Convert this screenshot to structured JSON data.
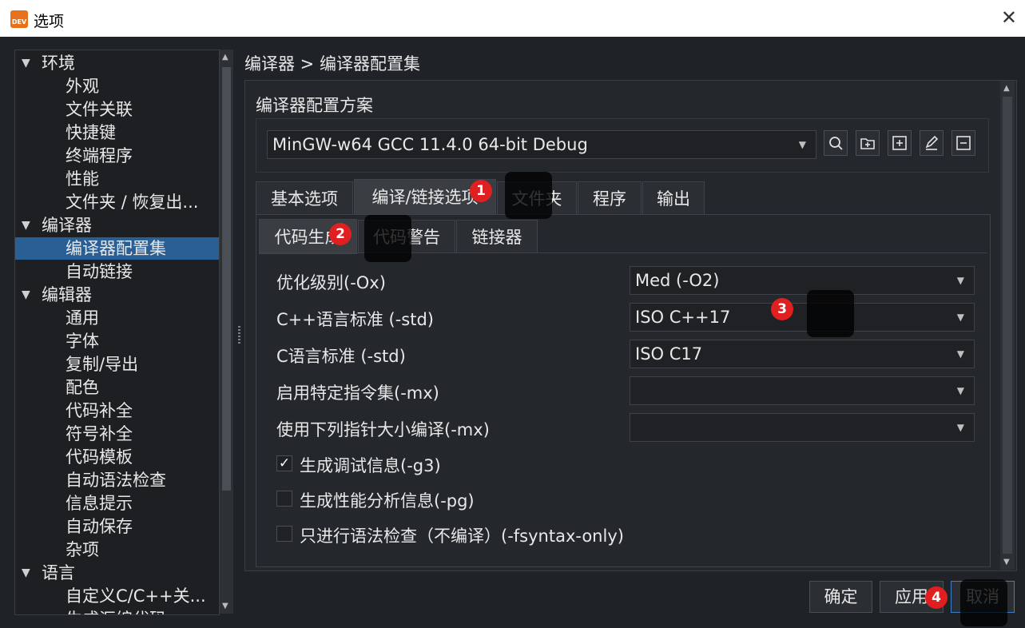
{
  "window": {
    "title": "选项",
    "app_icon_text": "DEV",
    "close_icon": "close-icon"
  },
  "tree": {
    "items": [
      {
        "label": "环境",
        "arrow": "▼"
      },
      {
        "label": "外观"
      },
      {
        "label": "文件关联"
      },
      {
        "label": "快捷键"
      },
      {
        "label": "终端程序"
      },
      {
        "label": "性能"
      },
      {
        "label": "文件夹 / 恢复出..."
      },
      {
        "label": "编译器",
        "arrow": "▼"
      },
      {
        "label": "编译器配置集"
      },
      {
        "label": "自动链接"
      },
      {
        "label": "编辑器",
        "arrow": "▼"
      },
      {
        "label": "通用"
      },
      {
        "label": "字体"
      },
      {
        "label": "复制/导出"
      },
      {
        "label": "配色"
      },
      {
        "label": "代码补全"
      },
      {
        "label": "符号补全"
      },
      {
        "label": "代码模板"
      },
      {
        "label": "自动语法检查"
      },
      {
        "label": "信息提示"
      },
      {
        "label": "自动保存"
      },
      {
        "label": "杂项"
      },
      {
        "label": "语言",
        "arrow": "▼"
      },
      {
        "label": "自定义C/C++关..."
      },
      {
        "label": "生成汇编代码"
      }
    ],
    "selected": "编译器配置集"
  },
  "breadcrumb": "编译器 > 编译器配置集",
  "profile": {
    "section_label": "编译器配置方案",
    "selected": "MinGW-w64 GCC 11.4.0 64-bit Debug",
    "actions": [
      "search-icon",
      "folder-add-icon",
      "plus-icon",
      "edit-icon",
      "minus-icon"
    ]
  },
  "tabs": {
    "items": [
      "基本选项",
      "编译/链接选项",
      "文件夹",
      "程序",
      "输出"
    ],
    "active": "编译/链接选项"
  },
  "subtabs": {
    "items": [
      "代码生成",
      "代码警告",
      "链接器"
    ],
    "active": "代码生成"
  },
  "options": [
    {
      "label": "优化级别(-Ox)",
      "value": "Med (-O2)"
    },
    {
      "label": "C++语言标准 (-std)",
      "value": "ISO C++17"
    },
    {
      "label": "C语言标准 (-std)",
      "value": "ISO C17"
    },
    {
      "label": "启用特定指令集(-mx)",
      "value": ""
    },
    {
      "label": "使用下列指针大小编译(-mx)",
      "value": ""
    }
  ],
  "checkboxes": [
    {
      "label": "生成调试信息(-g3)",
      "checked": true,
      "mark": "✓"
    },
    {
      "label": "生成性能分析信息(-pg)",
      "checked": false,
      "mark": ""
    },
    {
      "label": "只进行语法检查（不编译）(-fsyntax-only)",
      "checked": false,
      "mark": ""
    }
  ],
  "buttons": {
    "ok": "确定",
    "apply": "应用",
    "cancel": "取消"
  },
  "markers": [
    "1",
    "2",
    "3",
    "4"
  ],
  "colors": {
    "selection": "#2a5f95",
    "marker": "#e02020",
    "primary_border": "#3d7fc4"
  }
}
